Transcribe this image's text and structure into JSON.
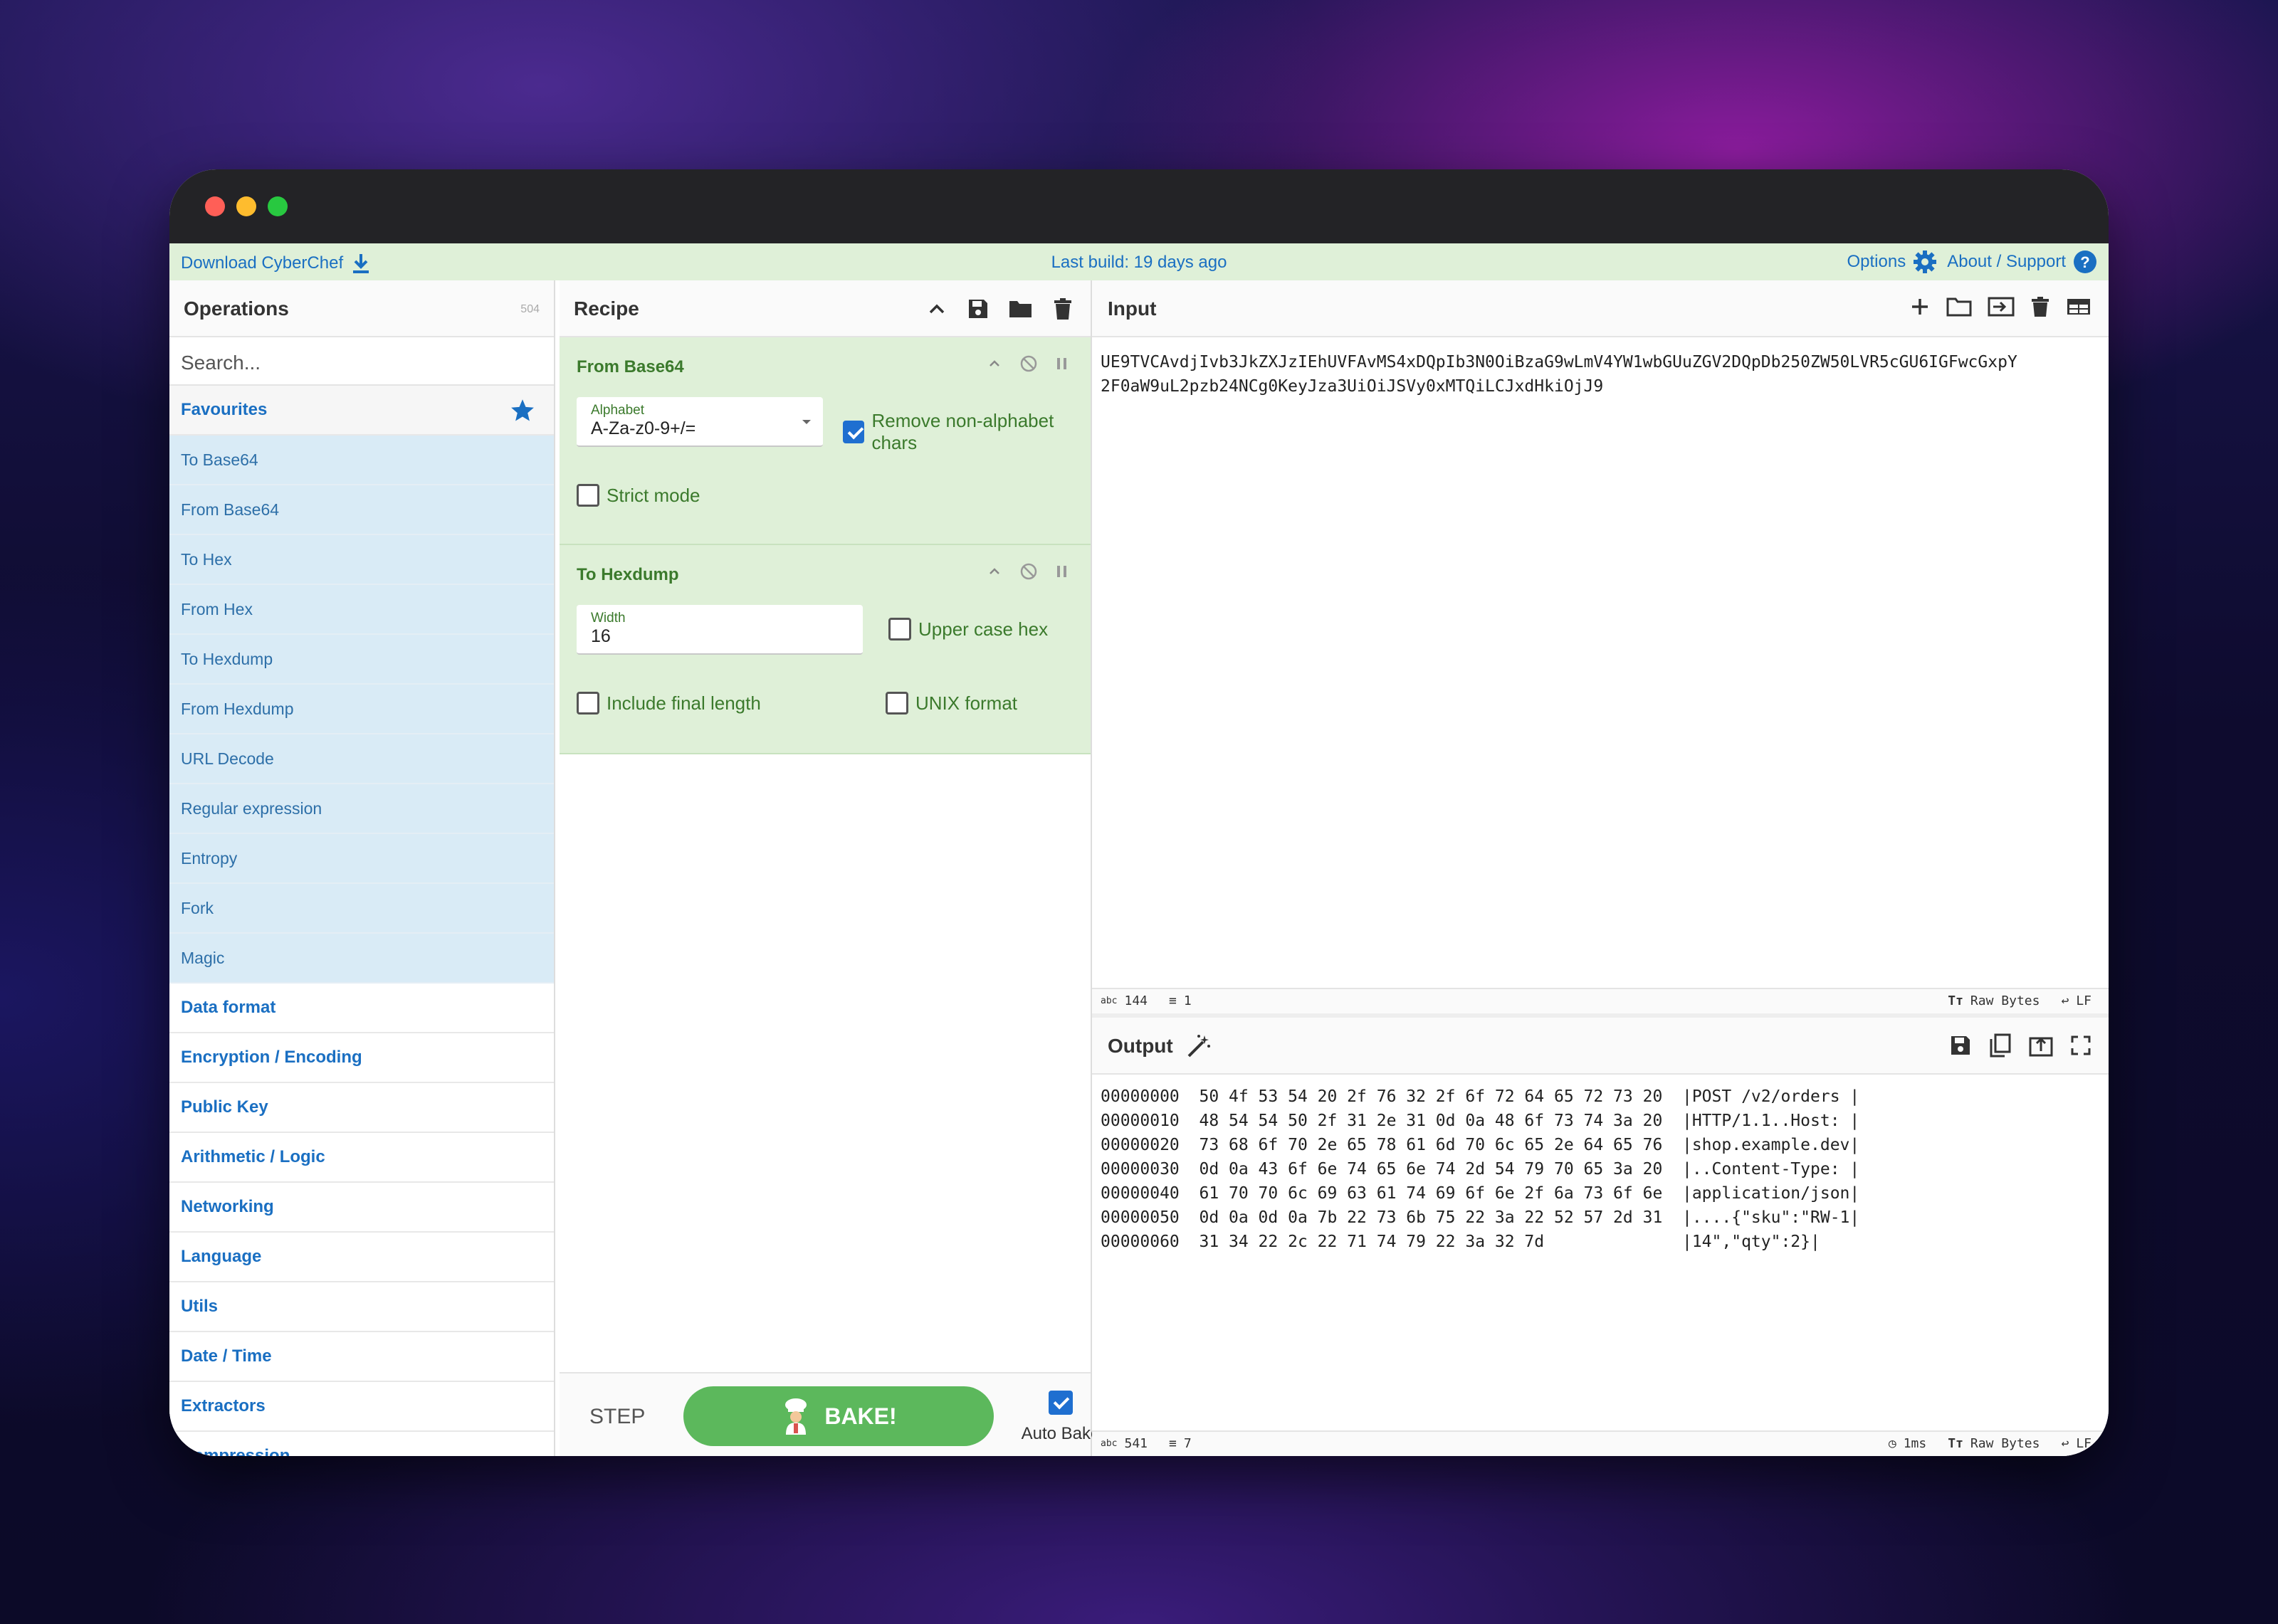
{
  "banner": {
    "download": "Download CyberChef",
    "last_build": "Last build: 19 days ago",
    "options": "Options",
    "about": "About / Support"
  },
  "operations": {
    "title": "Operations",
    "count": "504",
    "search_placeholder": "Search...",
    "favourites": "Favourites",
    "fav_items": [
      "To Base64",
      "From Base64",
      "To Hex",
      "From Hex",
      "To Hexdump",
      "From Hexdump",
      "URL Decode",
      "Regular expression",
      "Entropy",
      "Fork",
      "Magic"
    ],
    "categories": [
      "Data format",
      "Encryption / Encoding",
      "Public Key",
      "Arithmetic / Logic",
      "Networking",
      "Language",
      "Utils",
      "Date / Time",
      "Extractors",
      "Compression"
    ]
  },
  "recipe": {
    "title": "Recipe",
    "from_base64": {
      "title": "From Base64",
      "alphabet_label": "Alphabet",
      "alphabet_value": "A-Za-z0-9+/=",
      "remove_non_alpha": "Remove non-alphabet chars",
      "remove_non_alpha_checked": true,
      "strict_mode": "Strict mode",
      "strict_mode_checked": false
    },
    "to_hexdump": {
      "title": "To Hexdump",
      "width_label": "Width",
      "width_value": "16",
      "upper_case_hex": "Upper case hex",
      "include_final_length": "Include final length",
      "unix_format": "UNIX format"
    },
    "step": "STEP",
    "bake": "BAKE!",
    "auto_bake": "Auto Bake",
    "auto_bake_checked": true
  },
  "input": {
    "title": "Input",
    "lines": [
      "UE9TVCAvdjIvb3JkZXJzIEhUVFAvMS4xDQpIb3N0OiBzaG9wLmV4YW1wbGUuZGV2DQpDb250ZW50LVR5cGU6IGFwcGxpY",
      "2F0aW9uL2pzb24NCg0KeyJza3UiOiJSVy0xMTQiLCJxdHkiOjJ9"
    ],
    "status_chars": "144",
    "status_lines": "1",
    "encoding": "Raw Bytes",
    "eol": "LF"
  },
  "output": {
    "title": "Output",
    "lines": [
      "00000000  50 4f 53 54 20 2f 76 32 2f 6f 72 64 65 72 73 20  |POST /v2/orders |",
      "00000010  48 54 54 50 2f 31 2e 31 0d 0a 48 6f 73 74 3a 20  |HTTP/1.1..Host: |",
      "00000020  73 68 6f 70 2e 65 78 61 6d 70 6c 65 2e 64 65 76  |shop.example.dev|",
      "00000030  0d 0a 43 6f 6e 74 65 6e 74 2d 54 79 70 65 3a 20  |..Content-Type: |",
      "00000040  61 70 70 6c 69 63 61 74 69 6f 6e 2f 6a 73 6f 6e  |application/json|",
      "00000050  0d 0a 0d 0a 7b 22 73 6b 75 22 3a 22 52 57 2d 31  |....{\"sku\":\"RW-1|",
      "00000060  31 34 22 2c 22 71 74 79 22 3a 32 7d              |14\",\"qty\":2}|"
    ],
    "status_chars": "541",
    "status_lines": "7",
    "time": "1ms",
    "encoding": "Raw Bytes",
    "eol": "LF"
  },
  "colors": {
    "accent": "#1a6fc2",
    "recipe_green": "#dff0d8",
    "bake_green": "#5cb85c",
    "favourite_blue": "#d9ebf6"
  }
}
